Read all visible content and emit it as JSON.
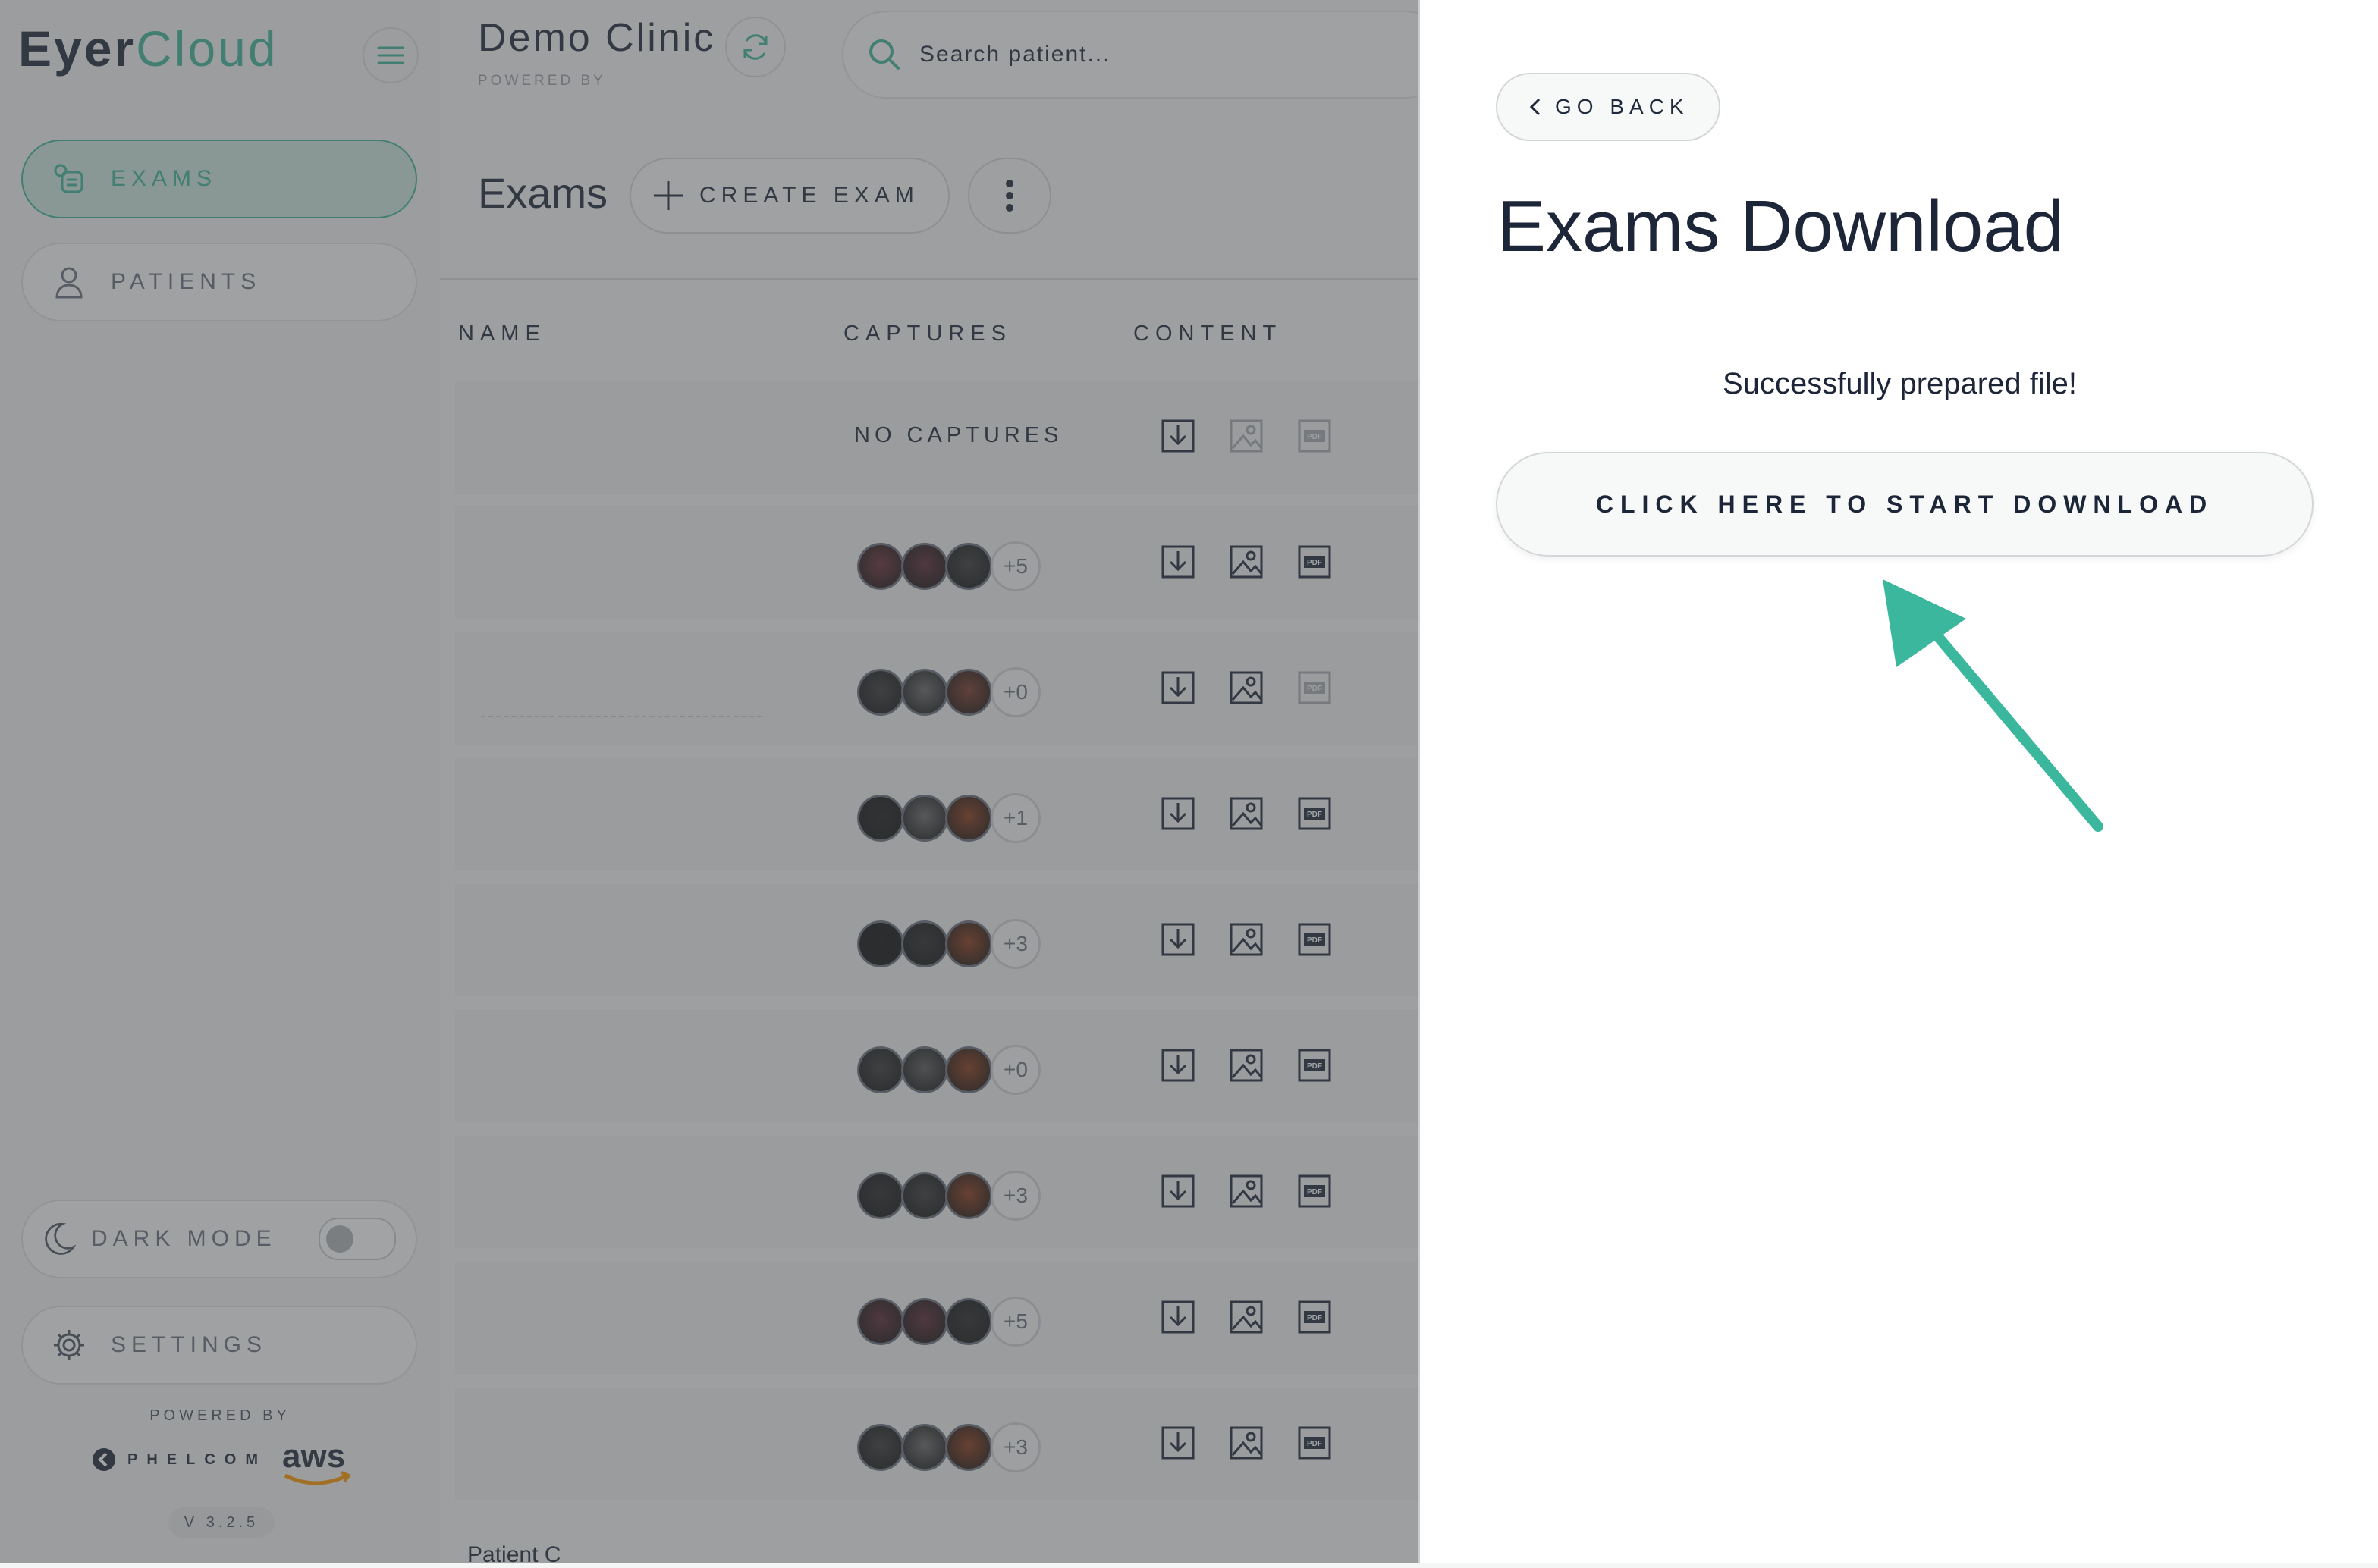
{
  "app": {
    "logo_part1": "Eyer",
    "logo_part2": "Cloud",
    "clinic_name": "Demo Clinic",
    "clinic_powered_by": "POWERED BY",
    "search_placeholder": "Search patient..."
  },
  "sidebar": {
    "items": [
      {
        "label": "EXAMS",
        "icon": "exams-icon",
        "active": true
      },
      {
        "label": "PATIENTS",
        "icon": "user-icon",
        "active": false
      }
    ],
    "dark_mode_label": "DARK MODE",
    "dark_mode_on": false,
    "settings_label": "SETTINGS",
    "powered_by": "POWERED BY",
    "partner1": "PHELCOM",
    "partner2": "aws",
    "version": "V 3.2.5"
  },
  "exams": {
    "title": "Exams",
    "create_label": "CREATE EXAM",
    "columns": [
      "NAME",
      "CAPTURES",
      "CONTENT"
    ],
    "no_captures_label": "NO CAPTURES",
    "rows": [
      {
        "captures": null,
        "more": null,
        "image": false,
        "pdf": false
      },
      {
        "captures": [
          "#6b2f3a",
          "#5a2a36",
          "#3a3a3a"
        ],
        "more": "+5",
        "image": true,
        "pdf": true
      },
      {
        "captures": [
          "#3a3a3a",
          "#6a6a6a",
          "#7a3a2a"
        ],
        "more": "+0",
        "image": true,
        "pdf": false
      },
      {
        "captures": [
          "#1e1e1e",
          "#6a6a6a",
          "#8a3a1a"
        ],
        "more": "+1",
        "image": true,
        "pdf": true
      },
      {
        "captures": [
          "#141414",
          "#2a2a2a",
          "#8a3a1a"
        ],
        "more": "+3",
        "image": true,
        "pdf": true
      },
      {
        "captures": [
          "#3a3a3a",
          "#5a5a5a",
          "#8a3a1a"
        ],
        "more": "+0",
        "image": true,
        "pdf": true
      },
      {
        "captures": [
          "#2a2a2a",
          "#3a3a3a",
          "#8a3a1a"
        ],
        "more": "+3",
        "image": true,
        "pdf": true
      },
      {
        "captures": [
          "#5a2a36",
          "#5a2a36",
          "#2a2a2a"
        ],
        "more": "+5",
        "image": true,
        "pdf": true
      },
      {
        "captures": [
          "#3a3a3a",
          "#6a6a6a",
          "#8a3a1a"
        ],
        "more": "+3",
        "image": true,
        "pdf": true
      }
    ],
    "partial_row_name": "Patient C"
  },
  "panel": {
    "go_back_label": "GO BACK",
    "title": "Exams Download",
    "status": "Successfully prepared file!",
    "download_label": "CLICK HERE TO START DOWNLOAD",
    "arrow_color": "#3ab79c"
  },
  "colors": {
    "accent": "#3fb59a",
    "text": "#1f2a3c"
  }
}
